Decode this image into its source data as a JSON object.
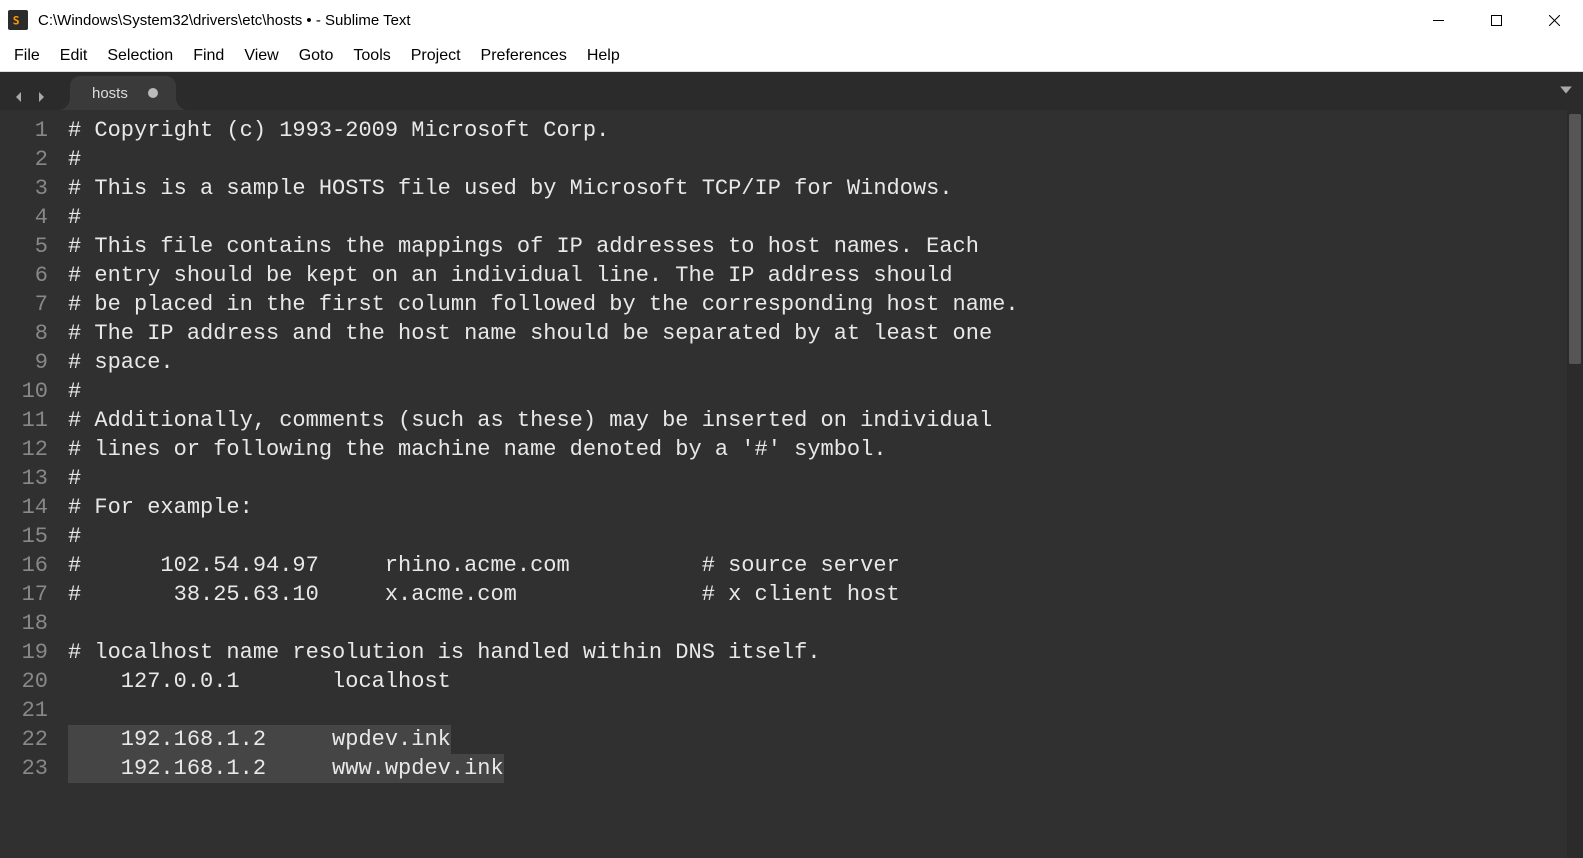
{
  "window": {
    "title": "C:\\Windows\\System32\\drivers\\etc\\hosts • - Sublime Text"
  },
  "menu": {
    "items": [
      "File",
      "Edit",
      "Selection",
      "Find",
      "View",
      "Goto",
      "Tools",
      "Project",
      "Preferences",
      "Help"
    ]
  },
  "tab": {
    "label": "hosts",
    "dirty": true
  },
  "code": {
    "lines": [
      "# Copyright (c) 1993-2009 Microsoft Corp.",
      "#",
      "# This is a sample HOSTS file used by Microsoft TCP/IP for Windows.",
      "#",
      "# This file contains the mappings of IP addresses to host names. Each",
      "# entry should be kept on an individual line. The IP address should",
      "# be placed in the first column followed by the corresponding host name.",
      "# The IP address and the host name should be separated by at least one",
      "# space.",
      "#",
      "# Additionally, comments (such as these) may be inserted on individual",
      "# lines or following the machine name denoted by a '#' symbol.",
      "#",
      "# For example:",
      "#",
      "#      102.54.94.97     rhino.acme.com          # source server",
      "#       38.25.63.10     x.acme.com              # x client host",
      "",
      "# localhost name resolution is handled within DNS itself.",
      "    127.0.0.1       localhost",
      "",
      "    192.168.1.2     wpdev.ink",
      "    192.168.1.2     www.wpdev.ink"
    ],
    "highlighted_lines": [
      21,
      22
    ]
  }
}
